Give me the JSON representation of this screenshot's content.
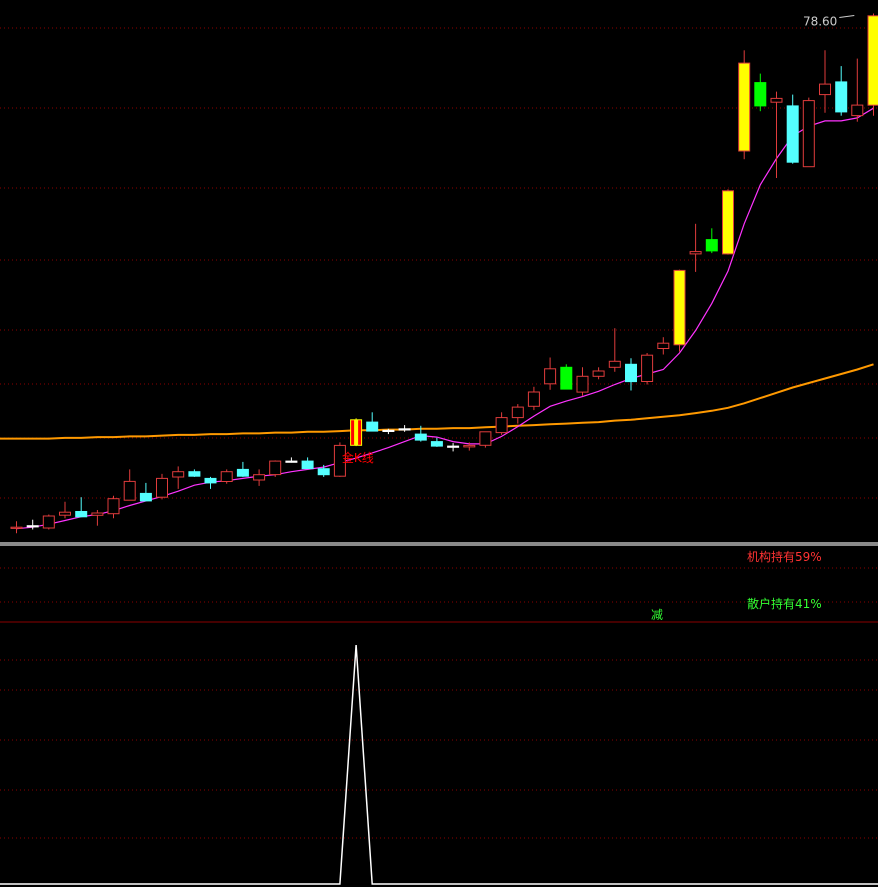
{
  "price_panel": {
    "top_price_label": "78.60",
    "signal_label": "金K线"
  },
  "holdings_panel": {
    "institution_label": "机构持有59%",
    "retail_label": "散户持有41%",
    "reduce_marker": "减"
  },
  "colors": {
    "background": "#000000",
    "grid": "#8b0000",
    "candle_up": "#e03c3c",
    "candle_down": "#54ffff",
    "candle_gold": "#ffff00",
    "candle_green": "#00ff00",
    "signal_candle": "#ff0000",
    "ma_short": "#ff33ff",
    "ma_long": "#ff9900",
    "spike": "#ffffff",
    "institution_text": "#ff3333",
    "retail_text": "#33ff33",
    "price_label_text": "#cccccc"
  },
  "chart_data": [
    {
      "type": "candlestick",
      "panel": "price",
      "ylim": [
        8.5,
        80.4
      ],
      "annotations": [
        {
          "text_key": "price_panel.top_price_label",
          "value": 78.6,
          "candle_index": 52
        },
        {
          "text_key": "price_panel.signal_label",
          "candle_index": 20
        }
      ],
      "candles": [
        {
          "o": 10.2,
          "h": 11.0,
          "l": 9.4,
          "c": 10.2,
          "k": "up"
        },
        {
          "o": 10.4,
          "h": 11.2,
          "l": 9.9,
          "c": 10.4,
          "k": "cross"
        },
        {
          "o": 10.1,
          "h": 11.9,
          "l": 9.9,
          "c": 11.7,
          "k": "up"
        },
        {
          "o": 11.8,
          "h": 13.6,
          "l": 11.4,
          "c": 12.2,
          "k": "up"
        },
        {
          "o": 12.3,
          "h": 14.2,
          "l": 11.7,
          "c": 11.6,
          "k": "down"
        },
        {
          "o": 11.8,
          "h": 12.5,
          "l": 10.4,
          "c": 12.1,
          "k": "up"
        },
        {
          "o": 12.0,
          "h": 14.4,
          "l": 11.4,
          "c": 14.0,
          "k": "up"
        },
        {
          "o": 16.3,
          "h": 17.9,
          "l": 15.4,
          "c": 13.8,
          "k": "up"
        },
        {
          "o": 14.7,
          "h": 16.1,
          "l": 13.9,
          "c": 13.7,
          "k": "down"
        },
        {
          "o": 14.2,
          "h": 17.3,
          "l": 13.9,
          "c": 16.7,
          "k": "up"
        },
        {
          "o": 16.9,
          "h": 18.3,
          "l": 15.3,
          "c": 17.6,
          "k": "up"
        },
        {
          "o": 17.6,
          "h": 17.9,
          "l": 16.9,
          "c": 17.0,
          "k": "down"
        },
        {
          "o": 16.7,
          "h": 16.9,
          "l": 15.3,
          "c": 16.1,
          "k": "down"
        },
        {
          "o": 16.3,
          "h": 17.9,
          "l": 16.0,
          "c": 17.6,
          "k": "up"
        },
        {
          "o": 17.9,
          "h": 18.9,
          "l": 16.9,
          "c": 17.0,
          "k": "down"
        },
        {
          "o": 16.5,
          "h": 17.9,
          "l": 15.7,
          "c": 17.2,
          "k": "up"
        },
        {
          "o": 17.2,
          "h": 19.1,
          "l": 16.9,
          "c": 19.0,
          "k": "up"
        },
        {
          "o": 19.0,
          "h": 19.5,
          "l": 18.8,
          "c": 19.0,
          "k": "cross"
        },
        {
          "o": 19.0,
          "h": 19.5,
          "l": 18.0,
          "c": 18.0,
          "k": "down"
        },
        {
          "o": 18.0,
          "h": 18.5,
          "l": 16.9,
          "c": 17.2,
          "k": "down"
        },
        {
          "o": 17.0,
          "h": 21.5,
          "l": 16.9,
          "c": 21.1,
          "k": "up"
        },
        {
          "o": 21.1,
          "h": 24.7,
          "l": 21.0,
          "c": 24.5,
          "k": "signal"
        },
        {
          "o": 24.2,
          "h": 25.5,
          "l": 23.4,
          "c": 23.0,
          "k": "down"
        },
        {
          "o": 23.0,
          "h": 23.3,
          "l": 22.6,
          "c": 23.1,
          "k": "cross"
        },
        {
          "o": 23.3,
          "h": 23.8,
          "l": 22.9,
          "c": 23.3,
          "k": "cross"
        },
        {
          "o": 22.6,
          "h": 23.7,
          "l": 21.6,
          "c": 21.8,
          "k": "down"
        },
        {
          "o": 21.6,
          "h": 22.1,
          "l": 20.9,
          "c": 21.0,
          "k": "down"
        },
        {
          "o": 21.0,
          "h": 21.4,
          "l": 20.3,
          "c": 21.0,
          "k": "cross"
        },
        {
          "o": 20.9,
          "h": 21.5,
          "l": 20.4,
          "c": 21.1,
          "k": "up"
        },
        {
          "o": 21.1,
          "h": 22.1,
          "l": 20.8,
          "c": 22.9,
          "k": "up"
        },
        {
          "o": 22.8,
          "h": 25.5,
          "l": 22.5,
          "c": 24.8,
          "k": "up"
        },
        {
          "o": 24.8,
          "h": 26.6,
          "l": 24.0,
          "c": 26.2,
          "k": "up"
        },
        {
          "o": 26.3,
          "h": 28.9,
          "l": 25.8,
          "c": 28.2,
          "k": "up"
        },
        {
          "o": 29.3,
          "h": 32.8,
          "l": 28.5,
          "c": 31.3,
          "k": "up"
        },
        {
          "o": 31.5,
          "h": 31.9,
          "l": 28.6,
          "c": 28.6,
          "k": "green"
        },
        {
          "o": 28.2,
          "h": 31.5,
          "l": 27.7,
          "c": 30.3,
          "k": "up"
        },
        {
          "o": 30.3,
          "h": 31.5,
          "l": 29.9,
          "c": 31.0,
          "k": "up"
        },
        {
          "o": 31.5,
          "h": 36.7,
          "l": 30.9,
          "c": 32.3,
          "k": "up"
        },
        {
          "o": 31.9,
          "h": 32.7,
          "l": 28.4,
          "c": 29.6,
          "k": "down"
        },
        {
          "o": 29.6,
          "h": 33.4,
          "l": 29.2,
          "c": 33.1,
          "k": "up"
        },
        {
          "o": 34.0,
          "h": 35.5,
          "l": 33.2,
          "c": 34.7,
          "k": "up"
        },
        {
          "o": 34.5,
          "h": 44.5,
          "l": 33.6,
          "c": 44.4,
          "k": "gold"
        },
        {
          "o": 46.6,
          "h": 50.6,
          "l": 44.2,
          "c": 46.9,
          "k": "up"
        },
        {
          "o": 48.5,
          "h": 50.0,
          "l": 46.7,
          "c": 47.0,
          "k": "green"
        },
        {
          "o": 46.6,
          "h": 55.2,
          "l": 46.5,
          "c": 55.0,
          "k": "gold"
        },
        {
          "o": 60.3,
          "h": 73.7,
          "l": 59.2,
          "c": 72.0,
          "k": "gold"
        },
        {
          "o": 69.4,
          "h": 70.6,
          "l": 65.6,
          "c": 66.3,
          "k": "green"
        },
        {
          "o": 67.3,
          "h": 68.2,
          "l": 56.7,
          "c": 66.8,
          "k": "up"
        },
        {
          "o": 66.3,
          "h": 67.8,
          "l": 58.6,
          "c": 58.8,
          "k": "down"
        },
        {
          "o": 58.2,
          "h": 67.4,
          "l": 58.2,
          "c": 67.0,
          "k": "up"
        },
        {
          "o": 67.8,
          "h": 73.7,
          "l": 65.4,
          "c": 69.2,
          "k": "up"
        },
        {
          "o": 69.5,
          "h": 71.6,
          "l": 65.0,
          "c": 65.5,
          "k": "down"
        },
        {
          "o": 65.0,
          "h": 72.6,
          "l": 64.2,
          "c": 66.4,
          "k": "up"
        },
        {
          "o": 66.4,
          "h": 78.6,
          "l": 65.0,
          "c": 78.3,
          "k": "gold"
        }
      ],
      "ma_short": [
        10.0,
        10.2,
        10.6,
        11.1,
        11.6,
        11.9,
        12.4,
        13.1,
        13.7,
        14.3,
        15.0,
        15.8,
        16.2,
        16.4,
        16.7,
        17.0,
        17.2,
        17.6,
        17.9,
        18.2,
        18.8,
        19.4,
        20.1,
        20.8,
        21.6,
        22.4,
        22.2,
        21.6,
        21.3,
        21.3,
        22.3,
        23.6,
        25.0,
        26.3,
        27.0,
        27.6,
        28.3,
        29.2,
        30.0,
        30.6,
        31.2,
        33.4,
        36.4,
        40.0,
        44.3,
        50.6,
        55.8,
        59.3,
        62.3,
        63.6,
        64.3,
        64.3,
        64.7,
        66.0
      ],
      "ma_long": [
        22.0,
        22.0,
        22.0,
        22.1,
        22.1,
        22.2,
        22.2,
        22.3,
        22.3,
        22.4,
        22.5,
        22.5,
        22.6,
        22.6,
        22.7,
        22.7,
        22.8,
        22.8,
        22.9,
        22.9,
        23.0,
        23.1,
        23.1,
        23.2,
        23.2,
        23.3,
        23.3,
        23.4,
        23.4,
        23.5,
        23.6,
        23.7,
        23.8,
        23.9,
        24.0,
        24.1,
        24.2,
        24.4,
        24.5,
        24.7,
        24.9,
        25.1,
        25.4,
        25.7,
        26.1,
        26.7,
        27.4,
        28.1,
        28.8,
        29.4,
        30.0,
        30.6,
        31.2,
        31.9
      ]
    },
    {
      "type": "line",
      "panel": "signal",
      "ylim": [
        0,
        1
      ],
      "values": [
        0,
        0,
        0,
        0,
        0,
        0,
        0,
        0,
        0,
        0,
        0,
        0,
        0,
        0,
        0,
        0,
        0,
        0,
        0,
        0,
        0,
        1,
        0,
        0,
        0,
        0,
        0,
        0,
        0,
        0,
        0,
        0,
        0,
        0,
        0,
        0,
        0,
        0,
        0,
        0,
        0,
        0,
        0,
        0,
        0,
        0,
        0,
        0,
        0,
        0,
        0,
        0,
        0,
        0
      ]
    }
  ]
}
